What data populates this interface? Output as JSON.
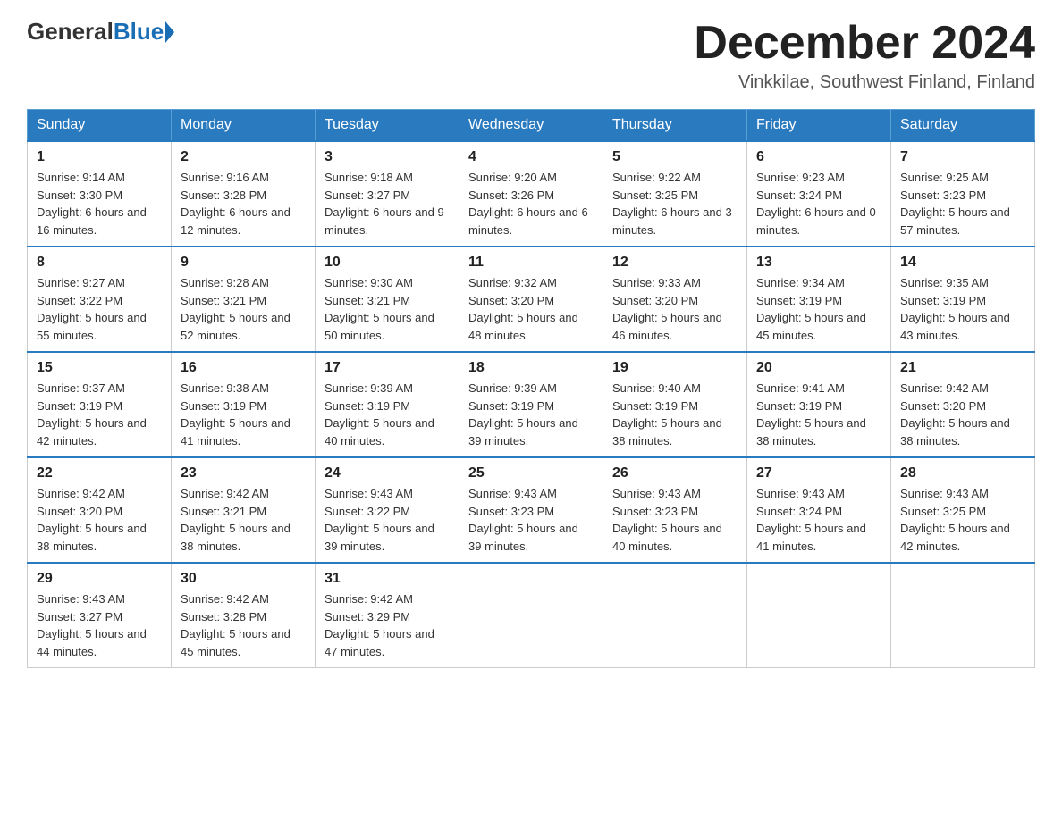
{
  "header": {
    "logo_general": "General",
    "logo_blue": "Blue",
    "month_title": "December 2024",
    "location": "Vinkkilae, Southwest Finland, Finland"
  },
  "weekdays": [
    "Sunday",
    "Monday",
    "Tuesday",
    "Wednesday",
    "Thursday",
    "Friday",
    "Saturday"
  ],
  "weeks": [
    [
      {
        "day": "1",
        "sunrise": "9:14 AM",
        "sunset": "3:30 PM",
        "daylight": "6 hours and 16 minutes."
      },
      {
        "day": "2",
        "sunrise": "9:16 AM",
        "sunset": "3:28 PM",
        "daylight": "6 hours and 12 minutes."
      },
      {
        "day": "3",
        "sunrise": "9:18 AM",
        "sunset": "3:27 PM",
        "daylight": "6 hours and 9 minutes."
      },
      {
        "day": "4",
        "sunrise": "9:20 AM",
        "sunset": "3:26 PM",
        "daylight": "6 hours and 6 minutes."
      },
      {
        "day": "5",
        "sunrise": "9:22 AM",
        "sunset": "3:25 PM",
        "daylight": "6 hours and 3 minutes."
      },
      {
        "day": "6",
        "sunrise": "9:23 AM",
        "sunset": "3:24 PM",
        "daylight": "6 hours and 0 minutes."
      },
      {
        "day": "7",
        "sunrise": "9:25 AM",
        "sunset": "3:23 PM",
        "daylight": "5 hours and 57 minutes."
      }
    ],
    [
      {
        "day": "8",
        "sunrise": "9:27 AM",
        "sunset": "3:22 PM",
        "daylight": "5 hours and 55 minutes."
      },
      {
        "day": "9",
        "sunrise": "9:28 AM",
        "sunset": "3:21 PM",
        "daylight": "5 hours and 52 minutes."
      },
      {
        "day": "10",
        "sunrise": "9:30 AM",
        "sunset": "3:21 PM",
        "daylight": "5 hours and 50 minutes."
      },
      {
        "day": "11",
        "sunrise": "9:32 AM",
        "sunset": "3:20 PM",
        "daylight": "5 hours and 48 minutes."
      },
      {
        "day": "12",
        "sunrise": "9:33 AM",
        "sunset": "3:20 PM",
        "daylight": "5 hours and 46 minutes."
      },
      {
        "day": "13",
        "sunrise": "9:34 AM",
        "sunset": "3:19 PM",
        "daylight": "5 hours and 45 minutes."
      },
      {
        "day": "14",
        "sunrise": "9:35 AM",
        "sunset": "3:19 PM",
        "daylight": "5 hours and 43 minutes."
      }
    ],
    [
      {
        "day": "15",
        "sunrise": "9:37 AM",
        "sunset": "3:19 PM",
        "daylight": "5 hours and 42 minutes."
      },
      {
        "day": "16",
        "sunrise": "9:38 AM",
        "sunset": "3:19 PM",
        "daylight": "5 hours and 41 minutes."
      },
      {
        "day": "17",
        "sunrise": "9:39 AM",
        "sunset": "3:19 PM",
        "daylight": "5 hours and 40 minutes."
      },
      {
        "day": "18",
        "sunrise": "9:39 AM",
        "sunset": "3:19 PM",
        "daylight": "5 hours and 39 minutes."
      },
      {
        "day": "19",
        "sunrise": "9:40 AM",
        "sunset": "3:19 PM",
        "daylight": "5 hours and 38 minutes."
      },
      {
        "day": "20",
        "sunrise": "9:41 AM",
        "sunset": "3:19 PM",
        "daylight": "5 hours and 38 minutes."
      },
      {
        "day": "21",
        "sunrise": "9:42 AM",
        "sunset": "3:20 PM",
        "daylight": "5 hours and 38 minutes."
      }
    ],
    [
      {
        "day": "22",
        "sunrise": "9:42 AM",
        "sunset": "3:20 PM",
        "daylight": "5 hours and 38 minutes."
      },
      {
        "day": "23",
        "sunrise": "9:42 AM",
        "sunset": "3:21 PM",
        "daylight": "5 hours and 38 minutes."
      },
      {
        "day": "24",
        "sunrise": "9:43 AM",
        "sunset": "3:22 PM",
        "daylight": "5 hours and 39 minutes."
      },
      {
        "day": "25",
        "sunrise": "9:43 AM",
        "sunset": "3:23 PM",
        "daylight": "5 hours and 39 minutes."
      },
      {
        "day": "26",
        "sunrise": "9:43 AM",
        "sunset": "3:23 PM",
        "daylight": "5 hours and 40 minutes."
      },
      {
        "day": "27",
        "sunrise": "9:43 AM",
        "sunset": "3:24 PM",
        "daylight": "5 hours and 41 minutes."
      },
      {
        "day": "28",
        "sunrise": "9:43 AM",
        "sunset": "3:25 PM",
        "daylight": "5 hours and 42 minutes."
      }
    ],
    [
      {
        "day": "29",
        "sunrise": "9:43 AM",
        "sunset": "3:27 PM",
        "daylight": "5 hours and 44 minutes."
      },
      {
        "day": "30",
        "sunrise": "9:42 AM",
        "sunset": "3:28 PM",
        "daylight": "5 hours and 45 minutes."
      },
      {
        "day": "31",
        "sunrise": "9:42 AM",
        "sunset": "3:29 PM",
        "daylight": "5 hours and 47 minutes."
      },
      null,
      null,
      null,
      null
    ]
  ]
}
